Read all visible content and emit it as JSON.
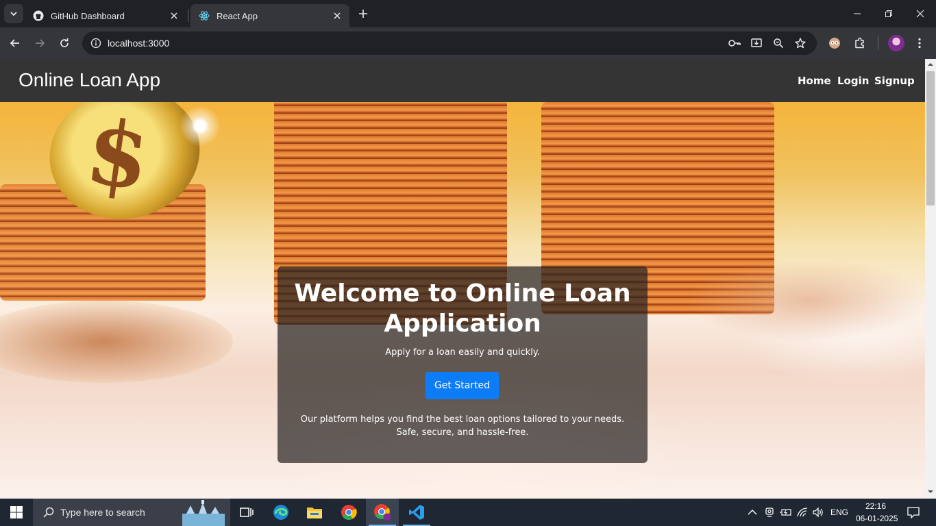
{
  "browser": {
    "tabs": [
      {
        "title": "GitHub Dashboard",
        "active": false
      },
      {
        "title": "React App",
        "active": true
      }
    ],
    "address": "localhost:3000"
  },
  "app": {
    "brand": "Online Loan App",
    "nav": [
      "Home",
      "Login",
      "Signup"
    ],
    "hero": {
      "title": "Welcome to Online Loan Application",
      "subtitle": "Apply for a loan easily and quickly.",
      "cta": "Get Started",
      "description": "Our platform helps you find the best loan options tailored to your needs. Safe, secure, and hassle-free."
    },
    "colors": {
      "navbar": "#343434",
      "cta": "#0d7df7",
      "card": "rgba(40,36,34,0.72)"
    }
  },
  "taskbar": {
    "search_placeholder": "Type here to search",
    "language": "ENG",
    "time": "22:16",
    "date": "06-01-2025",
    "apps": [
      "task-view-icon",
      "edge-icon",
      "file-explorer-icon",
      "chrome-icon",
      "chrome-profile-icon",
      "vscode-icon"
    ]
  }
}
